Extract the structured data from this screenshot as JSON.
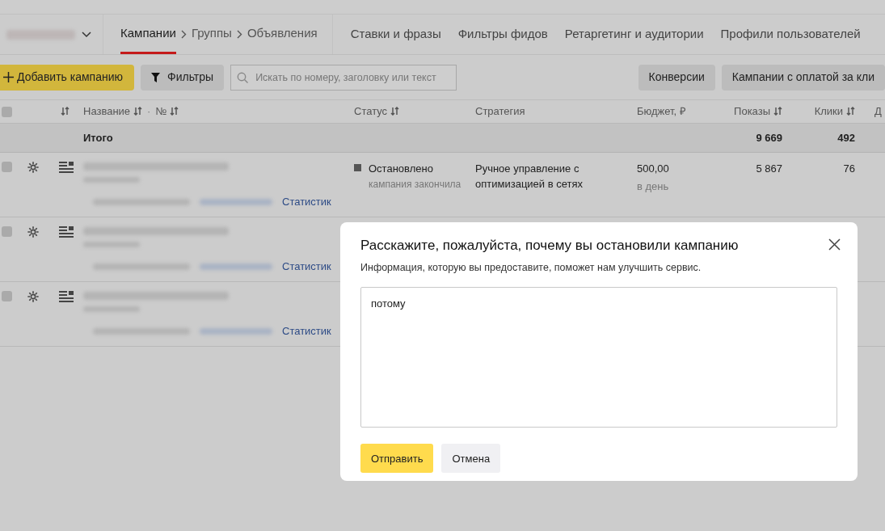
{
  "nav": {
    "breadcrumbs": [
      {
        "label": "Кампании",
        "selected": true
      },
      {
        "label": "Группы",
        "selected": false
      },
      {
        "label": "Объявления",
        "selected": false
      }
    ],
    "links": [
      "Ставки и фразы",
      "Фильтры фидов",
      "Ретаргетинг и аудитории",
      "Профили пользователей"
    ]
  },
  "toolbar": {
    "add_button": "Добавить кампанию",
    "filters_button": "Фильтры",
    "search": {
      "placeholder": "Искать по номеру, заголовку или текст"
    },
    "right_buttons": [
      "Конверсии",
      "Кампании с оплатой за кли"
    ]
  },
  "table": {
    "select_all": {
      "checked": false
    },
    "name_separator": "·",
    "columns": [
      {
        "label": "Название",
        "sortable": true
      },
      {
        "label": "№",
        "sortable": true
      },
      {
        "label": "Статус",
        "sortable": true
      },
      {
        "label": "Стратегия",
        "sortable": false
      },
      {
        "label": "Бюджет, ₽",
        "sortable": false
      },
      {
        "label": "Показы",
        "sortable": true
      },
      {
        "label": "Клики",
        "sortable": true
      },
      {
        "label": "Д",
        "sortable": false
      }
    ],
    "total": {
      "label": "Итого",
      "impressions": "9 669",
      "clicks": "492"
    },
    "rows": [
      {
        "checked": false,
        "link": "Статистик",
        "status": "Остановлено",
        "status_note": "кампания закончила",
        "strategy": "Ручное управление с оптимизацией в сетях",
        "budget": "500,00",
        "budget_period": "в день",
        "impressions": "5 867",
        "clicks": "76"
      },
      {
        "checked": false,
        "link": "Статистик"
      },
      {
        "checked": false,
        "link": "Статистик"
      }
    ]
  },
  "dialog": {
    "title": "Расскажите, пожалуйста, почему вы остановили кампанию",
    "subtitle": "Информация, которую вы предоставите, поможет нам улучшить сервис.",
    "answer": "потому",
    "submit": "Отправить",
    "cancel": "Отмена"
  }
}
